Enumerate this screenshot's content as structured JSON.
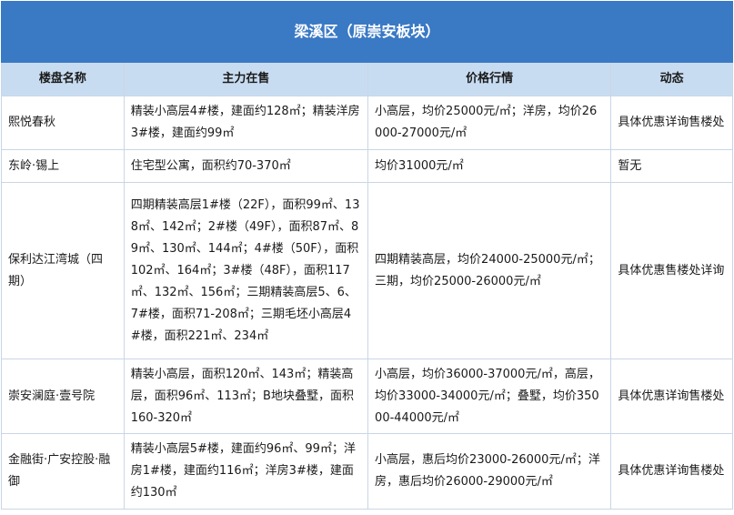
{
  "title": "梁溪区（原崇安板块）",
  "headers": [
    "楼盘名称",
    "主力在售",
    "价格行情",
    "动态"
  ],
  "rows": [
    {
      "name": "熙悦春秋",
      "on_sale": "精装小高层4#楼，建面约128㎡；精装洋房3#楼，建面约99㎡",
      "price": "小高层，均价25000元/㎡；洋房，均价26000-27000元/㎡",
      "status": "具体优惠详询售楼处"
    },
    {
      "name": "东岭·锡上",
      "on_sale": "住宅型公寓，面积约70-370㎡",
      "price": "均价31000元/㎡",
      "status": "暂无"
    },
    {
      "name": "保利达江湾城（四期）",
      "on_sale": "四期精装高层1#楼（22F），面积99㎡、138㎡、142㎡；2#楼（49F），面积87㎡、89㎡、130㎡、144㎡；4#楼（50F），面积102㎡、164㎡；3#楼（48F），面积117㎡、132㎡、156㎡；三期精装高层5、6、7#楼，面积71-208㎡；三期毛坯小高层4#楼，面积221㎡、234㎡",
      "price": "四期精装高层，均价24000-25000元/㎡；三期，均价25000-26000元/㎡",
      "status": "具体优惠售楼处详询"
    },
    {
      "name": "崇安澜庭·壹号院",
      "on_sale": "精装小高层，面积120㎡、143㎡；精装高层，面积96㎡、113㎡；B地块叠墅，面积160-320㎡",
      "price": "小高层，均价36000-37000元/㎡，高层，均价33000-34000元/㎡；叠墅，均价35000-44000元/㎡",
      "status": "具体优惠详询售楼处"
    },
    {
      "name": "金融街·广安控股·融御",
      "on_sale": "精装小高层5#楼，建面约96㎡、99㎡；洋房1#楼，建面约116㎡；洋房3#楼，建面约130㎡",
      "price": "小高层，惠后均价23000-26000元/㎡；洋房，惠后均价26000-29000元/㎡",
      "status": "具体优惠详询售楼处"
    }
  ],
  "colors": {
    "title_bg": "#3a79c4",
    "header_bg": "#c8dcf1",
    "border": "#c9d6e6"
  }
}
